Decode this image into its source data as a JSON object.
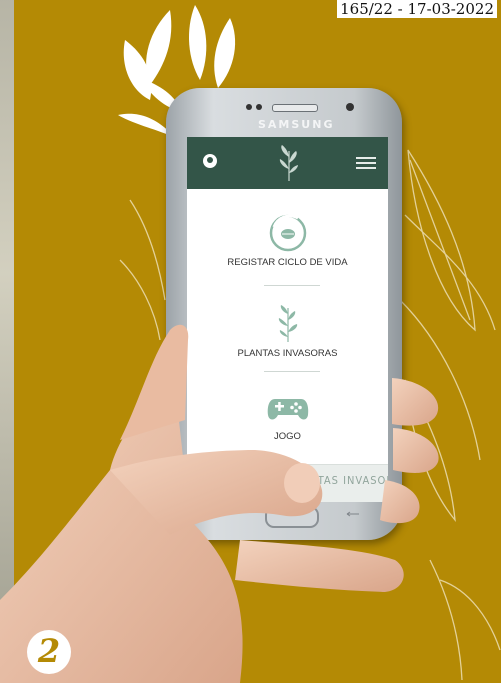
{
  "stamp": "165/22 - 17-03-2022",
  "phone": {
    "brand": "SAMSUNG"
  },
  "app": {
    "header_icons": [
      "user-icon",
      "plant-logo-icon",
      "hamburger-menu-icon"
    ],
    "menu": [
      {
        "label": "REGISTAR CICLO DE VIDA",
        "icon": "life-cycle-icon"
      },
      {
        "label": "PLANTAS INVASORAS",
        "icon": "plant-icon"
      },
      {
        "label": "JOGO",
        "icon": "gamepad-icon"
      }
    ],
    "bottom_banner": "CICLO DE VIDA  PLANTAS INVASORAS"
  },
  "step_number": "2",
  "colors": {
    "background": "#b48a05",
    "app_bar": "#335548",
    "accent_icon": "#8db8a6"
  }
}
